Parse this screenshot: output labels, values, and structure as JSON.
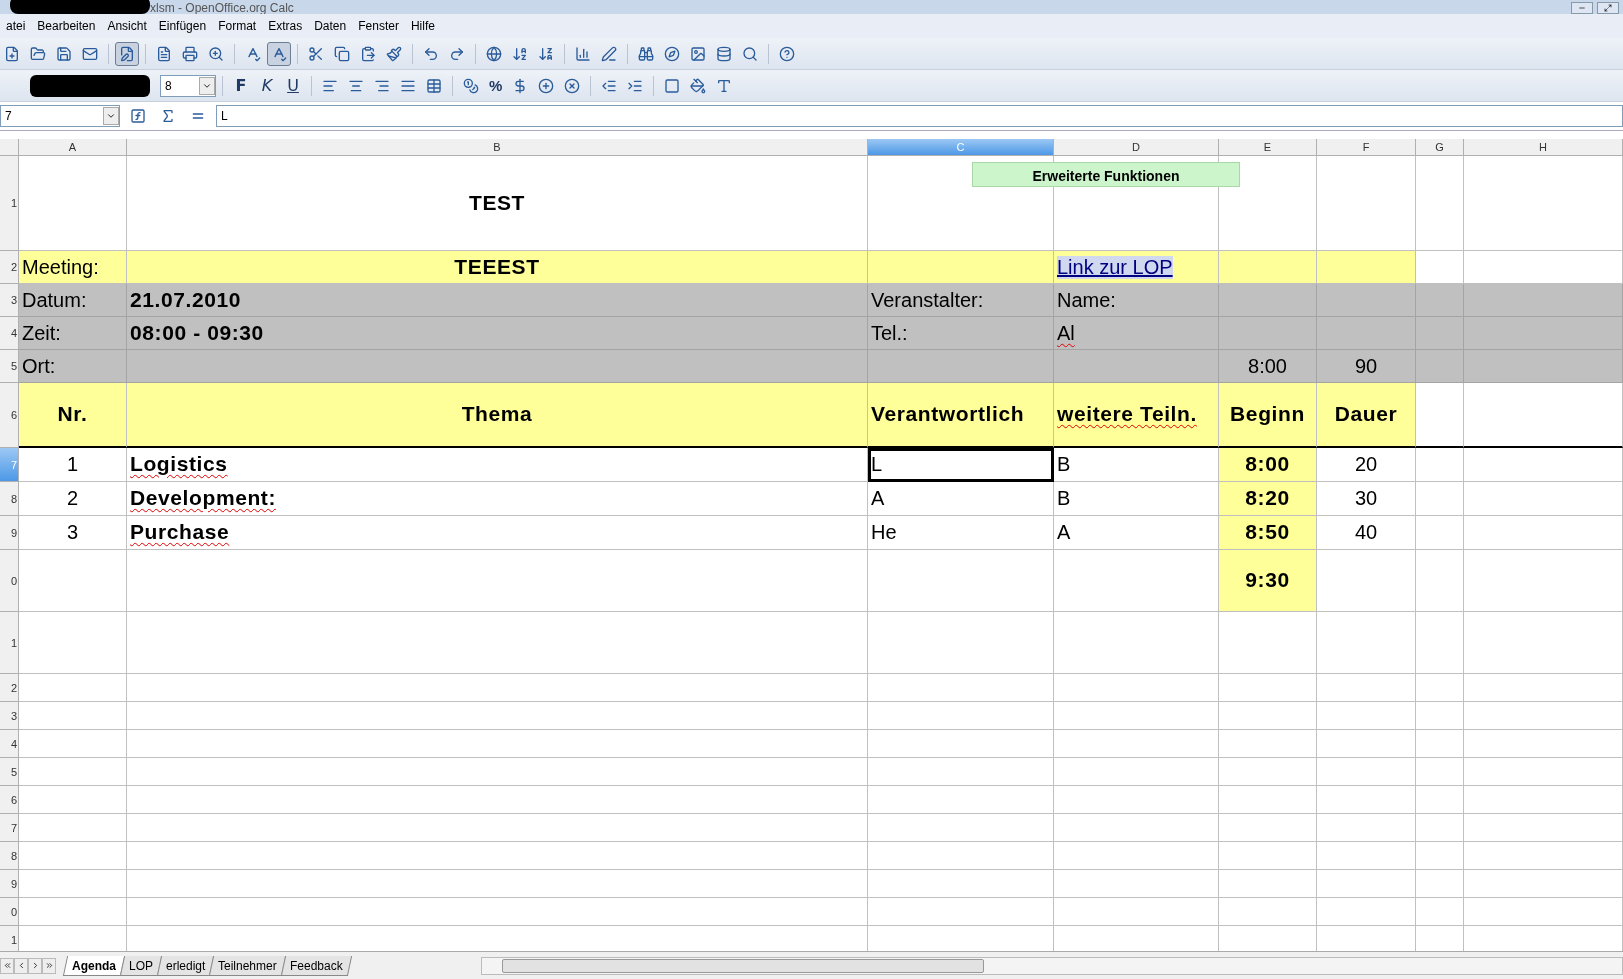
{
  "window": {
    "title": "xlsm - OpenOffice.org Calc"
  },
  "menu": [
    "atei",
    "Bearbeiten",
    "Ansicht",
    "Einfügen",
    "Format",
    "Extras",
    "Daten",
    "Fenster",
    "Hilfe"
  ],
  "format_bar": {
    "font_size": "8",
    "style_buttons": [
      {
        "label": "F",
        "kind": "bold"
      },
      {
        "label": "K",
        "kind": "italic"
      },
      {
        "label": "U",
        "kind": "underline"
      }
    ],
    "percent": "%"
  },
  "formula_bar": {
    "cell_ref": "7",
    "value": "L"
  },
  "sheet": {
    "columns": [
      {
        "label": "A",
        "selected": false
      },
      {
        "label": "B",
        "selected": false
      },
      {
        "label": "C",
        "selected": true
      },
      {
        "label": "D",
        "selected": false
      },
      {
        "label": "E",
        "selected": false
      },
      {
        "label": "F",
        "selected": false
      },
      {
        "label": "G",
        "selected": false
      },
      {
        "label": "H",
        "selected": false
      }
    ],
    "button": "Erweiterte Funktionen",
    "rows": [
      {
        "number": "1",
        "kind": "title",
        "selected": false,
        "cells": [
          {},
          {
            "text": "TEST",
            "bold": true
          },
          {},
          {},
          {},
          {},
          {},
          {}
        ]
      },
      {
        "number": "2",
        "kind": "meeting",
        "selected": false,
        "cells": [
          {
            "text": "Meeting:",
            "color": "#ffff99"
          },
          {
            "text": "TEEEST",
            "bold": true,
            "color": "#ffff99"
          },
          {
            "color": "#ffff99"
          },
          {
            "text": "Link zur LOP",
            "color": "#ffff99",
            "link": true
          },
          {
            "color": "#ffff99"
          },
          {
            "color": "#ffff99"
          },
          {},
          {}
        ]
      },
      {
        "number": "3",
        "kind": "info",
        "selected": false,
        "cells": [
          {
            "text": "Datum:",
            "color": "#c0c0c0"
          },
          {
            "text": "21.07.2010",
            "bold": true,
            "color": "#c0c0c0"
          },
          {
            "text": "Veranstalter:",
            "color": "#c0c0c0"
          },
          {
            "text": "Name:",
            "color": "#c0c0c0"
          },
          {
            "color": "#c0c0c0"
          },
          {
            "color": "#c0c0c0"
          },
          {
            "color": "#c0c0c0"
          },
          {
            "color": "#c0c0c0"
          }
        ]
      },
      {
        "number": "4",
        "kind": "info",
        "selected": false,
        "cells": [
          {
            "text": "Zeit:",
            "color": "#c0c0c0"
          },
          {
            "text": "08:00 - 09:30",
            "bold": true,
            "color": "#c0c0c0"
          },
          {
            "text": "Tel.:",
            "color": "#c0c0c0"
          },
          {
            "text": "Al",
            "color": "#c0c0c0",
            "misspelled": true
          },
          {
            "color": "#c0c0c0"
          },
          {
            "color": "#c0c0c0"
          },
          {
            "color": "#c0c0c0"
          },
          {
            "color": "#c0c0c0"
          }
        ]
      },
      {
        "number": "5",
        "kind": "info",
        "selected": false,
        "cells": [
          {
            "text": "Ort:",
            "color": "#c0c0c0"
          },
          {
            "color": "#c0c0c0"
          },
          {
            "color": "#c0c0c0"
          },
          {
            "color": "#c0c0c0"
          },
          {
            "text": "8:00",
            "color": "#c0c0c0"
          },
          {
            "text": "90",
            "color": "#c0c0c0"
          },
          {
            "color": "#c0c0c0"
          },
          {
            "color": "#c0c0c0"
          }
        ]
      },
      {
        "number": "6",
        "kind": "header",
        "selected": false,
        "cells": [
          {
            "text": "Nr.",
            "bold": true,
            "color": "#ffff99"
          },
          {
            "text": "Thema",
            "bold": true,
            "color": "#ffff99"
          },
          {
            "text": "Verantwortlich",
            "bold": true,
            "color": "#ffff99"
          },
          {
            "text": "weitere Teiln.",
            "bold": true,
            "color": "#ffff99",
            "misspelled": true
          },
          {
            "text": "Beginn",
            "bold": true,
            "color": "#ffff99"
          },
          {
            "text": "Dauer",
            "bold": true,
            "color": "#ffff99"
          },
          {},
          {}
        ]
      },
      {
        "number": "7",
        "kind": "item",
        "selected": true,
        "cells": [
          {
            "text": "1"
          },
          {
            "text": "Logistics",
            "bold": true,
            "misspelled": true
          },
          {
            "text": "L",
            "selected": true
          },
          {
            "text": "B"
          },
          {
            "text": "8:00",
            "bold": true,
            "color": "#ffff99"
          },
          {
            "text": "20"
          },
          {},
          {}
        ]
      },
      {
        "number": "8",
        "kind": "item",
        "selected": false,
        "cells": [
          {
            "text": "2"
          },
          {
            "text": "Development:",
            "bold": true,
            "misspelled": true
          },
          {
            "text": "A"
          },
          {
            "text": "B"
          },
          {
            "text": "8:20",
            "bold": true,
            "color": "#ffff99"
          },
          {
            "text": "30"
          },
          {},
          {}
        ]
      },
      {
        "number": "9",
        "kind": "item",
        "selected": false,
        "cells": [
          {
            "text": "3"
          },
          {
            "text": "Purchase",
            "bold": true,
            "misspelled": true
          },
          {
            "text": "He"
          },
          {
            "text": "A"
          },
          {
            "text": "8:50",
            "bold": true,
            "color": "#ffff99"
          },
          {
            "text": "40"
          },
          {},
          {}
        ]
      },
      {
        "number": "0",
        "kind": "tall",
        "selected": false,
        "cells": [
          {},
          {},
          {},
          {},
          {
            "text": "9:30",
            "bold": true,
            "color": "#ffff99"
          },
          {},
          {},
          {}
        ]
      },
      {
        "number": "1",
        "kind": "tall",
        "selected": false,
        "cells": [
          {},
          {},
          {},
          {},
          {},
          {},
          {},
          {}
        ]
      },
      {
        "number": "2",
        "kind": "blank",
        "selected": false,
        "cells": [
          {},
          {},
          {},
          {},
          {},
          {},
          {},
          {}
        ]
      },
      {
        "number": "3",
        "kind": "blank",
        "selected": false,
        "cells": [
          {},
          {},
          {},
          {},
          {},
          {},
          {},
          {}
        ]
      },
      {
        "number": "4",
        "kind": "blank",
        "selected": false,
        "cells": [
          {},
          {},
          {},
          {},
          {},
          {},
          {},
          {}
        ]
      },
      {
        "number": "5",
        "kind": "blank",
        "selected": false,
        "cells": [
          {},
          {},
          {},
          {},
          {},
          {},
          {},
          {}
        ]
      },
      {
        "number": "6",
        "kind": "blank",
        "selected": false,
        "cells": [
          {},
          {},
          {},
          {},
          {},
          {},
          {},
          {}
        ]
      },
      {
        "number": "7",
        "kind": "blank",
        "selected": false,
        "cells": [
          {},
          {},
          {},
          {},
          {},
          {},
          {},
          {}
        ]
      },
      {
        "number": "8",
        "kind": "blank",
        "selected": false,
        "cells": [
          {},
          {},
          {},
          {},
          {},
          {},
          {},
          {}
        ]
      },
      {
        "number": "9",
        "kind": "blank",
        "selected": false,
        "cells": [
          {},
          {},
          {},
          {},
          {},
          {},
          {},
          {}
        ]
      },
      {
        "number": "0",
        "kind": "blank",
        "selected": false,
        "cells": [
          {},
          {},
          {},
          {},
          {},
          {},
          {},
          {}
        ]
      },
      {
        "number": "1",
        "kind": "blank",
        "selected": false,
        "cells": [
          {},
          {},
          {},
          {},
          {},
          {},
          {},
          {}
        ]
      }
    ]
  },
  "sheet_tabs": [
    {
      "label": "Agenda",
      "selected": true
    },
    {
      "label": "LOP",
      "selected": false
    },
    {
      "label": "erledigt",
      "selected": false
    },
    {
      "label": "Teilnehmer",
      "selected": false
    },
    {
      "label": "Feedback",
      "selected": false
    }
  ]
}
